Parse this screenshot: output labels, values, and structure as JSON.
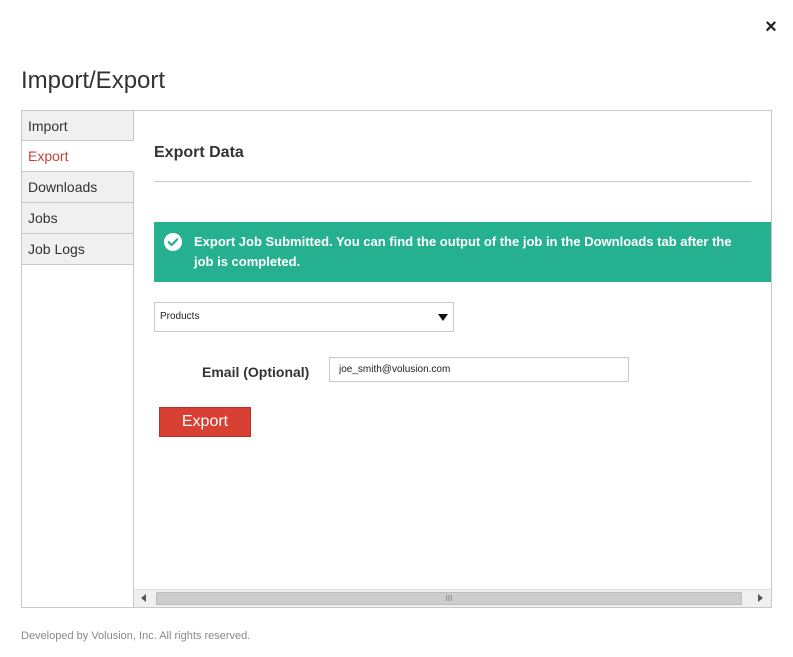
{
  "dialog": {
    "close_glyph": "×",
    "title": "Import/Export"
  },
  "tabs": [
    {
      "label": "Import",
      "active": false
    },
    {
      "label": "Export",
      "active": true
    },
    {
      "label": "Downloads",
      "active": false
    },
    {
      "label": "Jobs",
      "active": false
    },
    {
      "label": "Job Logs",
      "active": false
    }
  ],
  "export": {
    "section_title": "Export Data",
    "alert": {
      "icon": "check-circle-icon",
      "message": "Export Job Submitted. You can find the output of the job in the Downloads tab after the job is completed.",
      "color": "#25b08f"
    },
    "entity_select": {
      "selected": "Products"
    },
    "email": {
      "label": "Email (Optional)",
      "value": "joe_smith@volusion.com"
    },
    "export_button": "Export",
    "button_color": "#d84033"
  },
  "scrollbar": {
    "thumb_grip": "III"
  },
  "footer": {
    "text": "Developed by Volusion, Inc. All rights reserved."
  }
}
